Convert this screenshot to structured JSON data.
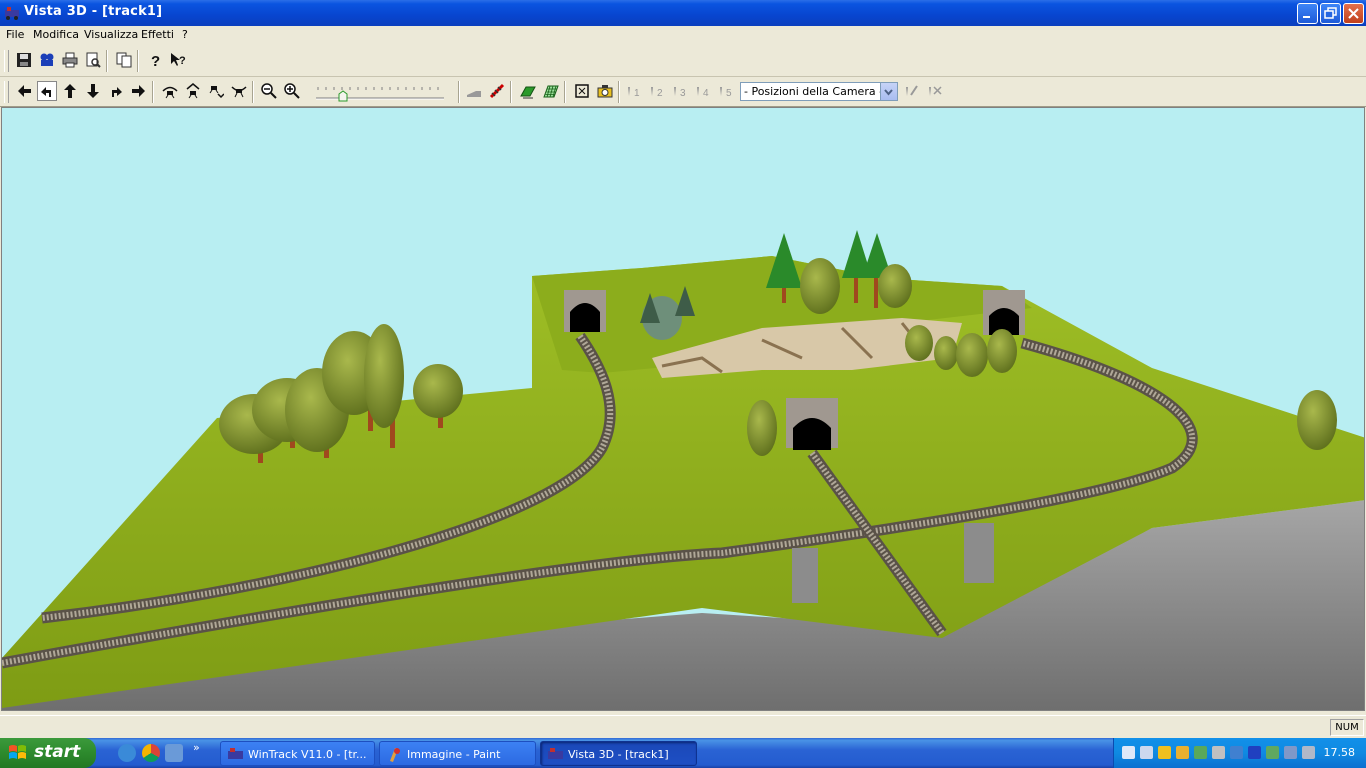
{
  "window": {
    "title": "Vista 3D - [track1]"
  },
  "menu": {
    "items": [
      "File",
      "Modifica",
      "Visualizza",
      "Effetti",
      "?"
    ]
  },
  "toolbar": {
    "camera_select": "- Posizioni della Camera -",
    "camera_positions": [
      "1",
      "2",
      "3",
      "4",
      "5"
    ]
  },
  "status": {
    "num": "NUM"
  },
  "taskbar": {
    "start": "start",
    "tasks": [
      {
        "label": "WinTrack  V11.0 - [tr..."
      },
      {
        "label": "Immagine - Paint"
      },
      {
        "label": "Vista 3D - [track1]"
      }
    ],
    "clock": "17.58"
  },
  "colors": {
    "sky": "#b8eef2",
    "grass": "#8fae1e",
    "cliff": "#8a8a8a",
    "title_bar": "#0a54e0"
  }
}
